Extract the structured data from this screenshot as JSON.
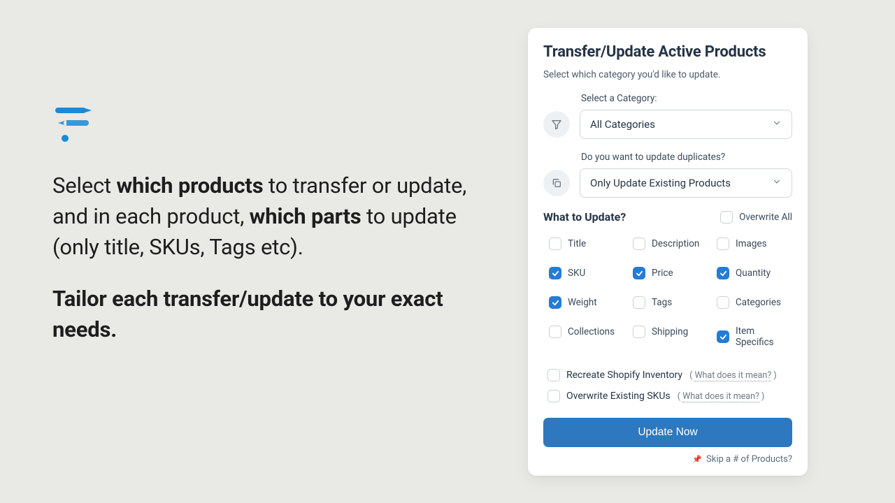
{
  "left": {
    "headline_parts": {
      "p1a": "Select ",
      "p1b": "which products",
      "p1c": " to transfer or update, and in each product, ",
      "p1d": "which parts",
      "p1e": " to update (only title, SKUs, Tags etc).",
      "p2": "Tailor each transfer/update to your exact needs."
    }
  },
  "card": {
    "title": "Transfer/Update Active Products",
    "subtext": "Select which category you'd like to update.",
    "category": {
      "label": "Select a Category:",
      "value": "All Categories"
    },
    "duplicates": {
      "label": "Do you want to update duplicates?",
      "value": "Only Update Existing Products"
    },
    "whatHeader": "What to Update?",
    "overwriteAll": {
      "label": "Overwrite All",
      "checked": false
    },
    "options": [
      {
        "key": "title",
        "label": "Title",
        "checked": false
      },
      {
        "key": "description",
        "label": "Description",
        "checked": false
      },
      {
        "key": "images",
        "label": "Images",
        "checked": false
      },
      {
        "key": "sku",
        "label": "SKU",
        "checked": true
      },
      {
        "key": "price",
        "label": "Price",
        "checked": true
      },
      {
        "key": "quantity",
        "label": "Quantity",
        "checked": true
      },
      {
        "key": "weight",
        "label": "Weight",
        "checked": true
      },
      {
        "key": "tags",
        "label": "Tags",
        "checked": false
      },
      {
        "key": "categories",
        "label": "Categories",
        "checked": false
      },
      {
        "key": "collections",
        "label": "Collections",
        "checked": false
      },
      {
        "key": "shipping",
        "label": "Shipping",
        "checked": false
      },
      {
        "key": "itemspecifics",
        "label": "Item Specifics",
        "checked": true
      }
    ],
    "extras": [
      {
        "key": "recreate",
        "label": "Recreate Shopify Inventory",
        "hint": "What does it mean?",
        "checked": false
      },
      {
        "key": "overwriteskus",
        "label": "Overwrite Existing SKUs",
        "hint": "What does it mean?",
        "checked": false
      }
    ],
    "submit": "Update Now",
    "footerLink": "Skip a # of Products?"
  }
}
